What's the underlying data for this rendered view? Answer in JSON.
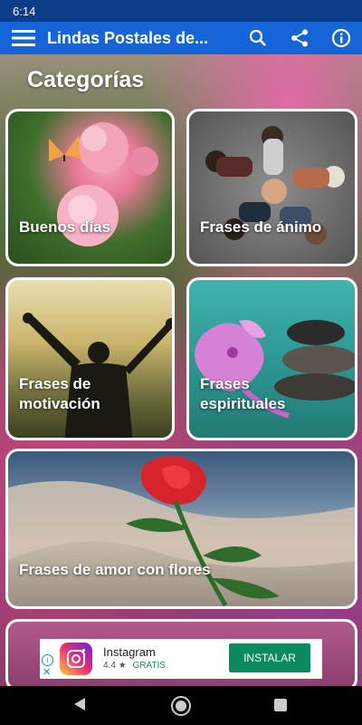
{
  "status_bar": {
    "time": "6:14"
  },
  "app_bar": {
    "title": "Lindas Postales de...",
    "menu_icon": "hamburger-icon",
    "search_icon": "search-icon",
    "share_icon": "share-icon",
    "info_icon": "info-icon"
  },
  "section": {
    "title": "Categorías"
  },
  "categories": [
    {
      "label": "Buenos días"
    },
    {
      "label": "Frases de ánimo"
    },
    {
      "label_line1": "Frases de",
      "label_line2": "motivación"
    },
    {
      "label_line1": "Frases",
      "label_line2": "espirituales"
    },
    {
      "label": "Frases de amor con flores"
    }
  ],
  "ad": {
    "app_name": "Instagram",
    "rating": "4.4",
    "price": "GRATIS",
    "install_label": "INSTALAR"
  },
  "colors": {
    "status_bar": "#0c3b8a",
    "app_bar": "#1565d8",
    "install_button": "#0b8a5f"
  }
}
